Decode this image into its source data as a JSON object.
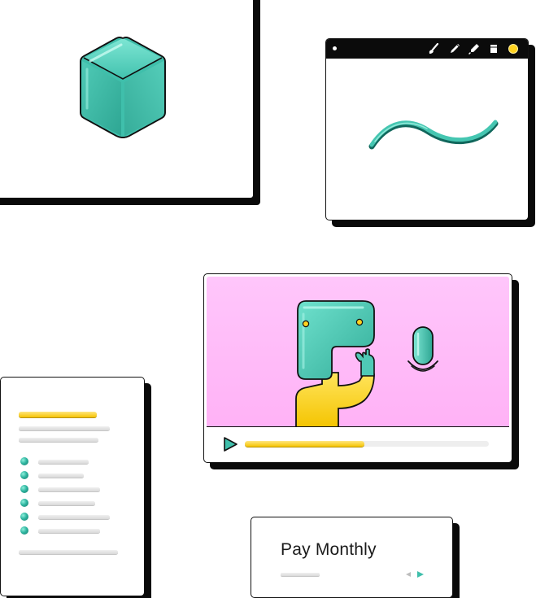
{
  "pricing": {
    "title": "Pay Monthly"
  },
  "video": {
    "progress_percent": 49
  },
  "draw_tools": [
    "brush-icon",
    "pen-icon",
    "marker-icon",
    "eraser-icon",
    "color-swatch-icon"
  ],
  "colors": {
    "teal": "#3fbfab",
    "yellow": "#f6c400",
    "pink": "#ffb8f7",
    "outline": "#111111"
  }
}
